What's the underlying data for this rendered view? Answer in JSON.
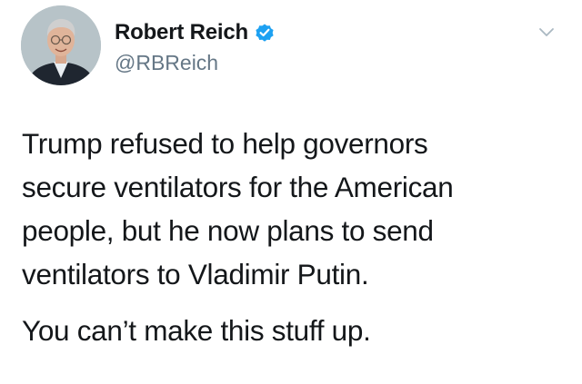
{
  "author": {
    "display_name": "Robert Reich",
    "handle": "@RBReich",
    "verified_icon": "verified-badge-icon",
    "avatar": "profile-photo"
  },
  "menu_icon": "chevron-down-icon",
  "tweet": {
    "paragraph_1": "Trump refused to help governors\nsecure ventilators for the American\npeople, but he now plans to send\nventilators to Vladimir Putin.",
    "paragraph_2": "You can’t make this stuff up."
  },
  "colors": {
    "text": "#14171a",
    "secondary_text": "#657786",
    "verified_blue": "#1da1f2"
  }
}
